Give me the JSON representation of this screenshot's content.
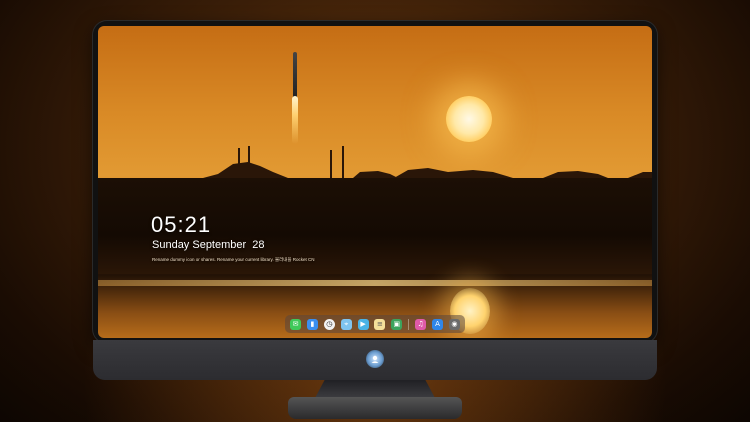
{
  "lock_screen": {
    "time": "05:21",
    "date": "Sunday September  28",
    "caption": "Rename dummy icon or shares. Rename your current library. 불러내을  Rocket CN"
  },
  "dock": {
    "apps": [
      {
        "name": "messages-icon",
        "color": "#3fc95a",
        "glyph": "💬"
      },
      {
        "name": "files-icon",
        "color": "#3b8ff0",
        "glyph": "▮"
      },
      {
        "name": "clock-icon",
        "color": "#f2f2f2",
        "glyph": "◷"
      },
      {
        "name": "maps-icon",
        "color": "#7fc4f0",
        "glyph": "⌖"
      },
      {
        "name": "video-icon",
        "color": "#4ab3e6",
        "glyph": "▶"
      },
      {
        "name": "notes-icon",
        "color": "#f4e09a",
        "glyph": "≡"
      },
      {
        "name": "gallery-icon",
        "color": "#3ca35e",
        "glyph": "▣"
      },
      {
        "name": "music-icon",
        "color": "#e05aa8",
        "glyph": "♫"
      },
      {
        "name": "appstore-icon",
        "color": "#2f86e8",
        "glyph": "A"
      },
      {
        "name": "camera-icon",
        "color": "#6b6b6b",
        "glyph": "◉"
      }
    ]
  },
  "colors": {
    "sky": "#d98a26",
    "sun": "#ffe9a8",
    "bezel": "#111111",
    "chin": "#3a3a3e"
  }
}
